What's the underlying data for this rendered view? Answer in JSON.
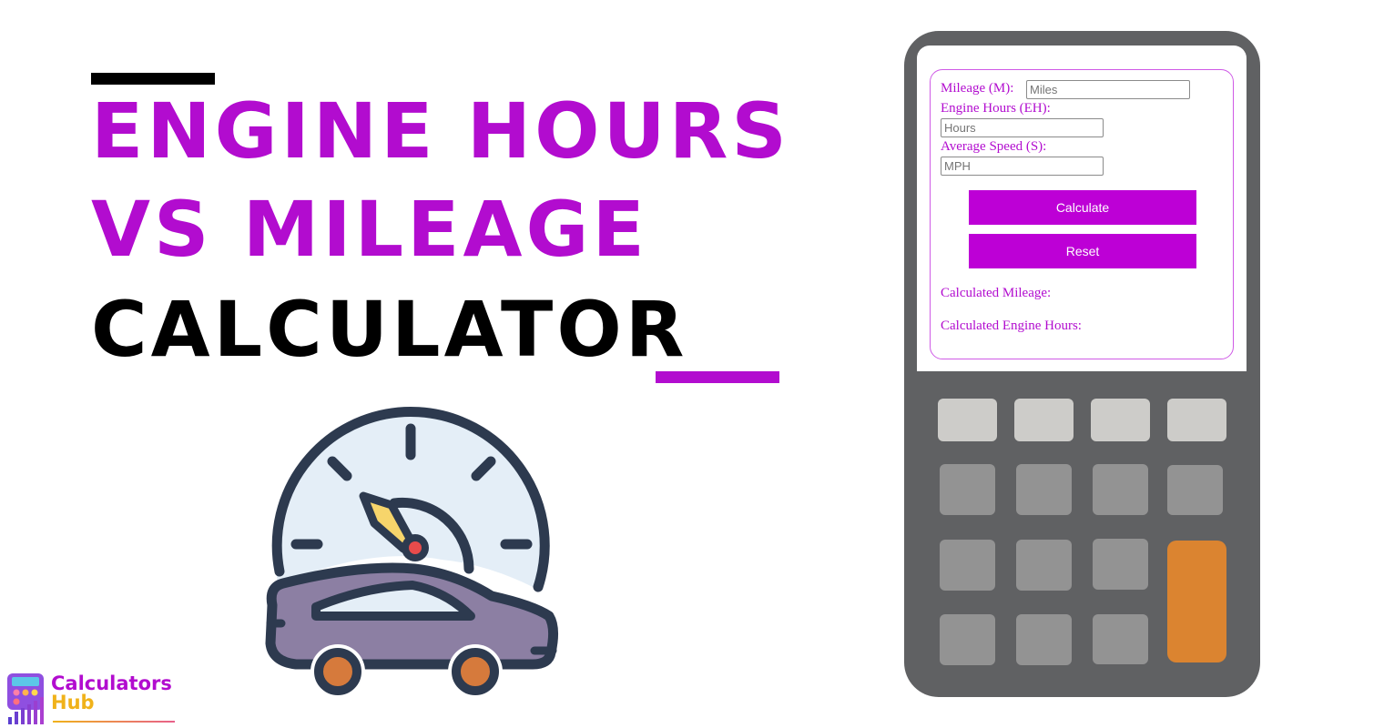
{
  "heading": {
    "line1": "Engine Hours",
    "line2": "VS Mileage",
    "line3": "Calculator"
  },
  "colors": {
    "accent_purple": "#b20ccf",
    "button_purple": "#bd00d6",
    "calculator_body": "#606163",
    "key_light": "#cdccc9",
    "key_mid": "#939393",
    "key_orange": "#db8430",
    "icon_outline": "#2d3a4f",
    "car_body": "#8c7fa3",
    "wheel": "#d67a3c",
    "dial_face": "#e4eef7",
    "needle": "#f7d56b",
    "needle_pivot": "#e84b4b"
  },
  "illustration": {
    "icons": [
      "speedometer-icon",
      "car-icon"
    ]
  },
  "calculator": {
    "fields": [
      {
        "label": "Mileage (M):",
        "placeholder": "Miles",
        "value": ""
      },
      {
        "label": "Engine Hours (EH):",
        "placeholder": "Hours",
        "value": ""
      },
      {
        "label": "Average Speed (S):",
        "placeholder": "MPH",
        "value": ""
      }
    ],
    "buttons": {
      "calculate": "Calculate",
      "reset": "Reset"
    },
    "results": {
      "mileage_label": "Calculated Mileage:",
      "mileage_value": "",
      "engine_hours_label": "Calculated Engine Hours:",
      "engine_hours_value": ""
    }
  },
  "logo": {
    "line1": "Calculators",
    "line2": "Hub"
  }
}
